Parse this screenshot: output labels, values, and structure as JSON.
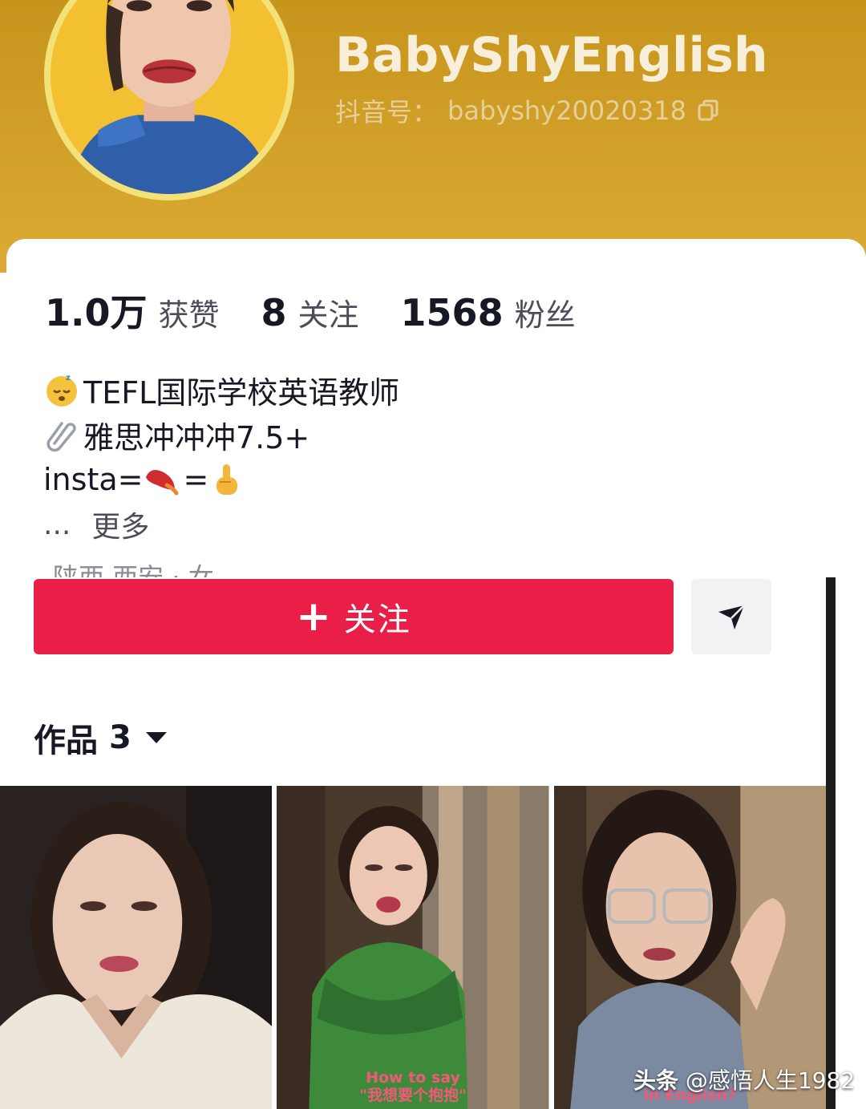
{
  "profile": {
    "username": "BabyShyEnglish",
    "douyin_id_label": "抖音号：",
    "douyin_id": "babyshy20020318"
  },
  "stats": [
    {
      "value": "1.0万",
      "label": "获赞"
    },
    {
      "value": "8",
      "label": "关注"
    },
    {
      "value": "1568",
      "label": "粉丝"
    }
  ],
  "bio": {
    "line1": "TEFL国际学校英语教师",
    "line2": "雅思冲冲冲7.5+",
    "line3_prefix": "insta=",
    "line3_mid": "=",
    "more_dots": "...",
    "more_label": "更多",
    "cut_text": "陕西 西安 · 女"
  },
  "actions": {
    "follow_plus": "+",
    "follow_label": "关注"
  },
  "works": {
    "label": "作品",
    "count": "3"
  },
  "videos": [
    {
      "caption_line1": "",
      "caption_line2": ""
    },
    {
      "caption_line1": "How to say",
      "caption_line2": "\"我想要个抱抱\""
    },
    {
      "caption_line1": "in English?",
      "caption_line2": ""
    }
  ],
  "watermark": {
    "brand": "头条",
    "author": "@感悟人生1982"
  },
  "colors": {
    "header_gold": "#d3a22a",
    "follow_red": "#ea1f47",
    "avatar_ring": "#f3e27a"
  }
}
